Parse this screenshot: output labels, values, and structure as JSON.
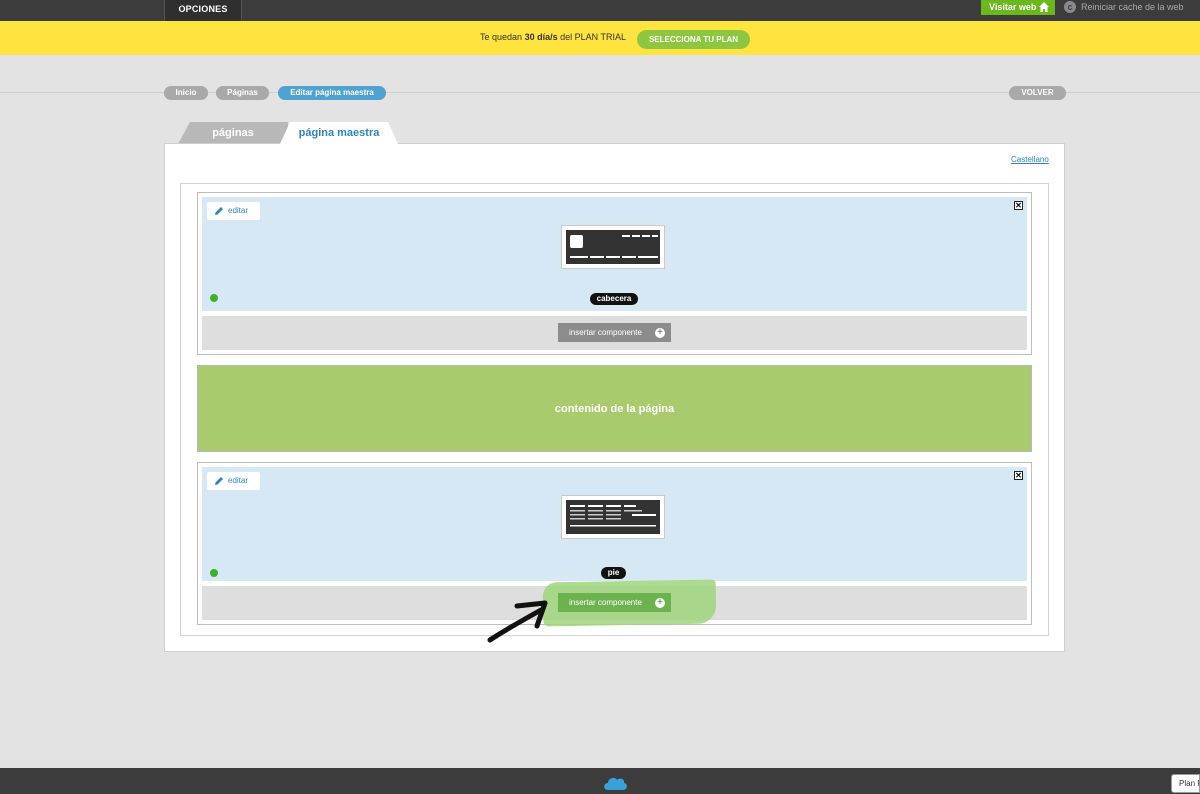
{
  "topbar": {
    "options_tab": "OPCIONES",
    "visit_web": "Visitar web",
    "reset_cache": "Reiniciar cache de la web"
  },
  "trial": {
    "prefix": "Te quedan",
    "days": "30 día/s",
    "suffix": "del PLAN TRIAL",
    "button": "SELECCIONA TU PLAN"
  },
  "breadcrumb": {
    "items": [
      {
        "label": "Inicio"
      },
      {
        "label": "Páginas"
      },
      {
        "label": "Editar página maestra"
      }
    ],
    "back": "VOLVER"
  },
  "tabs": [
    {
      "label": "páginas",
      "active": false
    },
    {
      "label": "página maestra",
      "active": true
    }
  ],
  "language": "Castellano",
  "sections": {
    "header": {
      "edit": "editar",
      "close": "✕",
      "badge": "cabecera",
      "insert": "insertar componente"
    },
    "content": {
      "label": "contenido de la página"
    },
    "footer": {
      "edit": "editar",
      "close": "✕",
      "badge": "pie",
      "insert": "insertar componente"
    }
  },
  "bottom": {
    "plan_tag": "Plan P"
  },
  "colors": {
    "accent_blue": "#2f84b8",
    "trial_yellow": "#ffe33f",
    "green": "#8dc63f",
    "content_green": "#a9cb6e",
    "section_blue": "#d6e8f3"
  },
  "icons": [
    "home-icon",
    "refresh-icon",
    "pencil-icon",
    "close-icon",
    "plus-icon",
    "cloud-icon"
  ]
}
